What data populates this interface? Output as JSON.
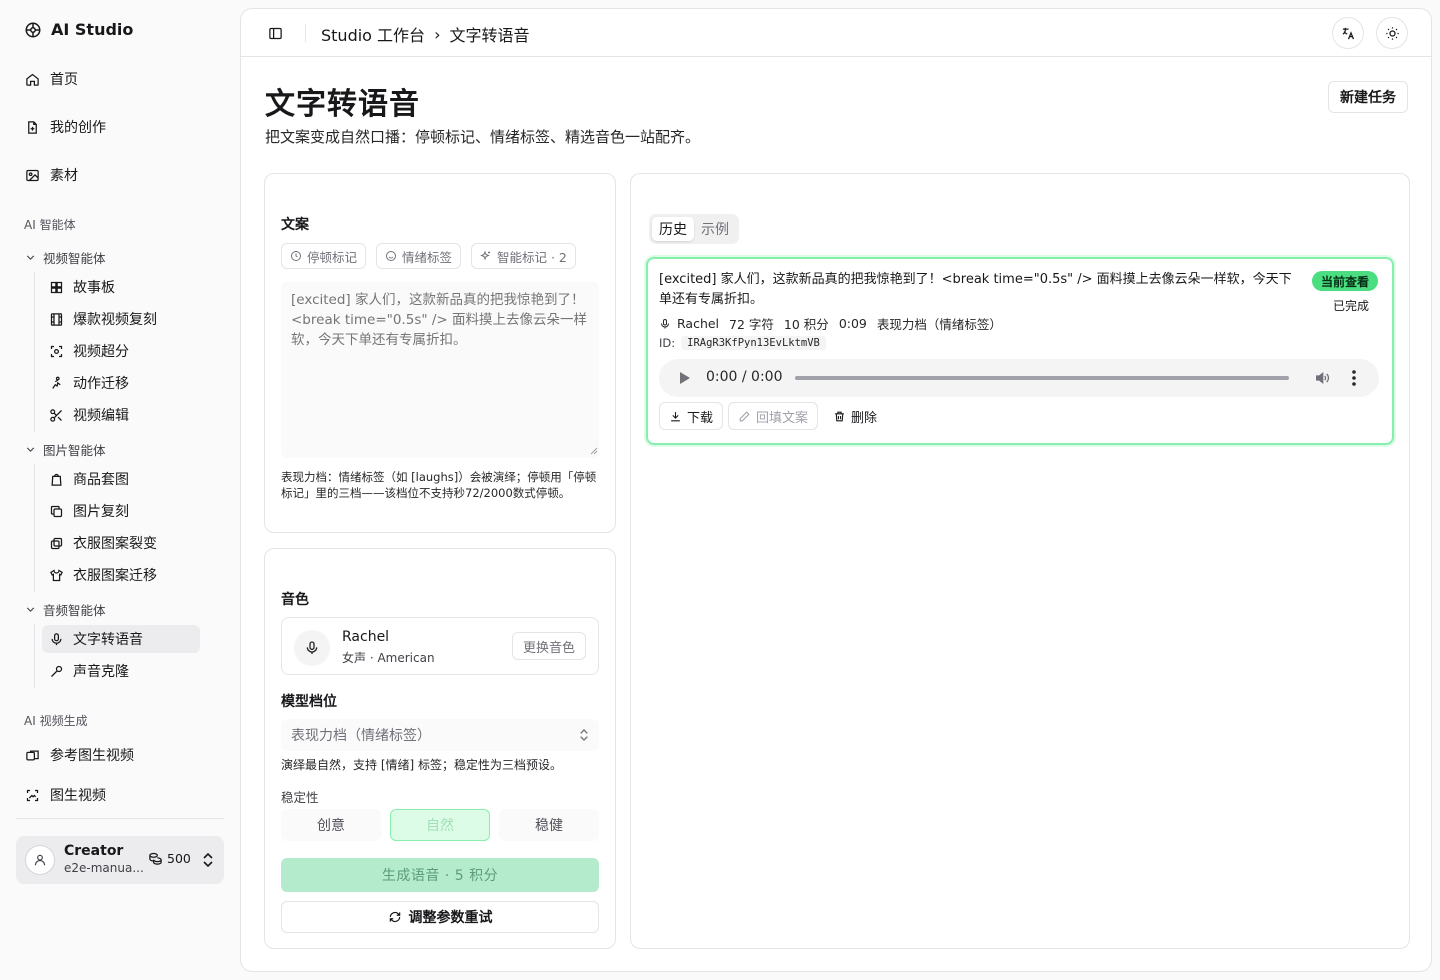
{
  "brand": {
    "name": "AI Studio"
  },
  "sidebar": {
    "top_items": [
      {
        "label": "首页",
        "icon": "home-icon"
      },
      {
        "label": "我的创作",
        "icon": "file-icon"
      },
      {
        "label": "素材",
        "icon": "image-icon"
      }
    ],
    "section_agents": "AI 智能体",
    "video_group": {
      "label": "视频智能体",
      "items": [
        "故事板",
        "爆款视频复刻",
        "视频超分",
        "动作迁移",
        "视频编辑"
      ]
    },
    "image_group": {
      "label": "图片智能体",
      "items": [
        "商品套图",
        "图片复刻",
        "衣服图案裂变",
        "衣服图案迁移"
      ]
    },
    "audio_group": {
      "label": "音频智能体",
      "items": [
        "文字转语音",
        "声音克隆"
      ]
    },
    "section_video_gen": "AI 视频生成",
    "video_gen_items": [
      "参考图生视频",
      "图生视频"
    ],
    "user": {
      "name": "Creator",
      "email": "e2e-manua...",
      "credits": "500"
    }
  },
  "header": {
    "breadcrumb_root": "Studio 工作台",
    "breadcrumb_sep": "›",
    "breadcrumb_current": "文字转语音"
  },
  "page": {
    "title": "文字转语音",
    "description": "把文案变成自然口播：停顿标记、情绪标签、精选音色一站配齐。",
    "new_task": "新建任务"
  },
  "script_card": {
    "label": "文案",
    "chips": [
      "停顿标记",
      "情绪标签",
      "智能标记 · 2"
    ],
    "placeholder": "[excited] 家人们，这款新品真的把我惊艳到了！<break time=\"0.5s\" /> 面料摸上去像云朵一样软，今天下单还有专属折扣。",
    "hint": "表现力档：情绪标签（如 [laughs]）会被演绎；停顿用「停顿标记」里的三档——该档位不支持秒72/2000数式停顿。"
  },
  "voice_card": {
    "voice_label": "音色",
    "voice_name": "Rachel",
    "voice_desc": "女声 · American",
    "change_voice": "更换音色",
    "model_label": "模型档位",
    "model_value": "表现力档（情绪标签）",
    "model_hint": "演绎最自然，支持 [情绪] 标签；稳定性为三档预设。",
    "stability_label": "稳定性",
    "stability_options": [
      "创意",
      "自然",
      "稳健"
    ],
    "stability_selected": "自然",
    "generate": "生成语音 · 5 积分",
    "retry": "调整参数重试"
  },
  "history_card": {
    "tabs": [
      "历史",
      "示例"
    ],
    "active_tab": "历史",
    "item": {
      "text": "[excited] 家人们，这款新品真的把我惊艳到了！<break time=\"0.5s\" /> 面料摸上去像云朵一样软，今天下单还有专属折扣。",
      "badge": "当前查看",
      "status": "已完成",
      "voice": "Rachel",
      "chars": "72 字符",
      "credits": "10 积分",
      "duration": "0:09",
      "mode": "表现力档（情绪标签）",
      "id_label": "ID:",
      "id": "IRAgR3KfPyn13EvLktmVB",
      "player_time": "0:00 / 0:00",
      "actions": [
        "下载",
        "回填文案",
        "删除"
      ]
    }
  },
  "colors": {
    "accent_green": "#4ade80",
    "accent_green_light": "#dcfce7",
    "generate_bg": "#b5ebcd"
  }
}
